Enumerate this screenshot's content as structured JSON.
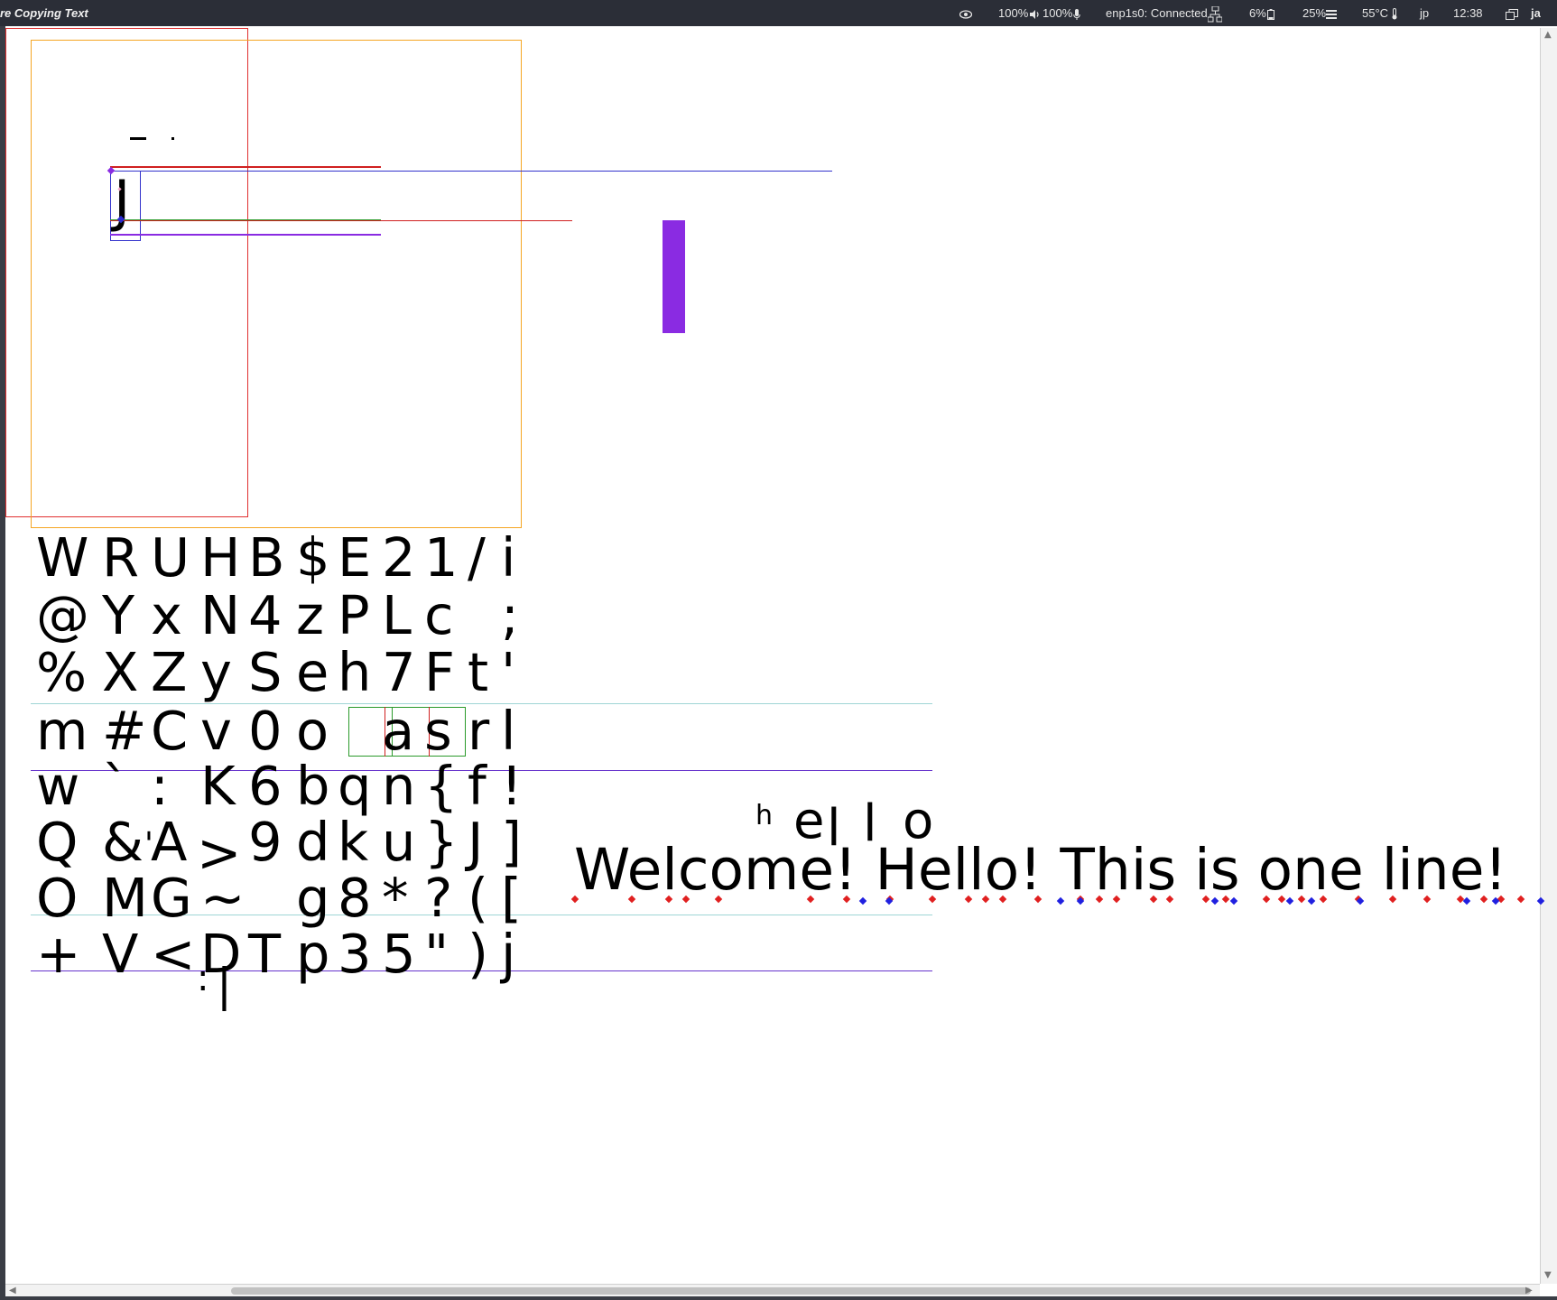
{
  "window": {
    "title": "re Copying Text"
  },
  "status_bar": {
    "brightness": "100%",
    "volume": "100%",
    "mic": "100%",
    "network": "enp1s0: Connected",
    "battery": "6%",
    "cpu": "25%",
    "temperature": "55°C",
    "keyboard_layout": "jp",
    "clock": "12:38",
    "input_method": "ja"
  },
  "canvas": {
    "single_glyph": "J",
    "glyph_grid": [
      [
        "W",
        "R",
        "U",
        "H",
        "B",
        "$",
        "E",
        "2",
        "1",
        "/",
        "i"
      ],
      [
        "@",
        "Y",
        "x",
        "N",
        "4",
        "z",
        "P",
        "L",
        "c",
        "",
        ";"
      ],
      [
        "%",
        "X",
        "Z",
        "y",
        "S",
        "e",
        "h",
        "7",
        "F",
        "t",
        "'"
      ],
      [
        "m",
        "#",
        "C",
        "v",
        "0",
        "o",
        "",
        "a",
        "s",
        "r",
        "l"
      ],
      [
        "w",
        "`",
        ":",
        "K",
        "6",
        "b",
        "q",
        "n",
        "{",
        "f",
        "!"
      ],
      [
        "Q",
        "&",
        "A",
        "",
        "9",
        "d",
        "k",
        "u",
        "}",
        "J",
        "]"
      ],
      [
        "O",
        "M",
        "G",
        "~",
        "",
        "g",
        "8",
        "*",
        "?",
        "(",
        "["
      ],
      [
        "+",
        "V",
        "<",
        "D",
        "T",
        "p",
        "3",
        "5",
        "\"",
        ")",
        "j"
      ]
    ],
    "extra_glyphs": [
      ">",
      ":",
      "|",
      "'",
      ".",
      "_"
    ],
    "spaced_word": [
      "h",
      "e",
      "l",
      "l",
      "o"
    ],
    "sentence": "Welcome! Hello! This is one line!"
  },
  "colors": {
    "topbar": "#2b2e37",
    "red_box": "#e03030",
    "orange_box": "#f5a623",
    "purple_bar": "#8a2be2",
    "blue_line": "#3333cc",
    "green_line": "#2a9a2a",
    "cyan_line": "#9fd5d5"
  }
}
